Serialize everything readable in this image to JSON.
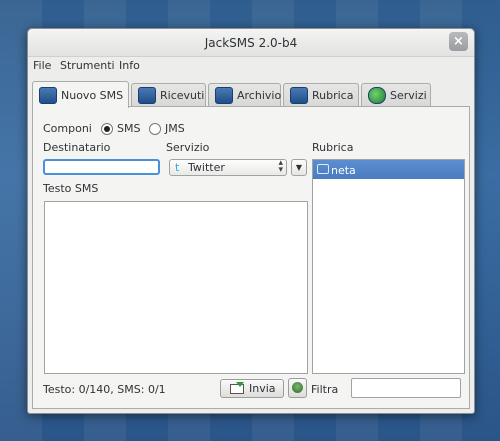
{
  "window": {
    "title": "JackSMS 2.0-b4",
    "close_glyph": "×"
  },
  "menu": [
    "File",
    "Strumenti",
    "Info"
  ],
  "tabs": [
    {
      "label": "Nuovo SMS",
      "icon": "compose-icon",
      "active": true
    },
    {
      "label": "Ricevuti",
      "icon": "inbox-icon",
      "active": false
    },
    {
      "label": "Archivio",
      "icon": "archive-icon",
      "active": false
    },
    {
      "label": "Rubrica",
      "icon": "address-book-icon",
      "active": false
    },
    {
      "label": "Servizi",
      "icon": "services-globe-icon",
      "active": false
    }
  ],
  "compose": {
    "componi_label": "Componi",
    "sms_label": "SMS",
    "jms_label": "JMS",
    "selected_mode": "SMS",
    "destinatario_label": "Destinatario",
    "destinatario_value": "",
    "servizio_label": "Servizio",
    "servizio_value": "Twitter",
    "testo_label": "Testo SMS",
    "testo_value": "",
    "counter": "Testo: 0/140, SMS: 0/1",
    "send_label": "Invia"
  },
  "rubrica": {
    "label": "Rubrica",
    "contacts": [
      "neta"
    ],
    "filter_label": "Filtra",
    "filter_value": ""
  },
  "colors": {
    "selection": "#4a7cc0",
    "focus": "#4a90d9",
    "desktop": "#2f5d8e"
  }
}
